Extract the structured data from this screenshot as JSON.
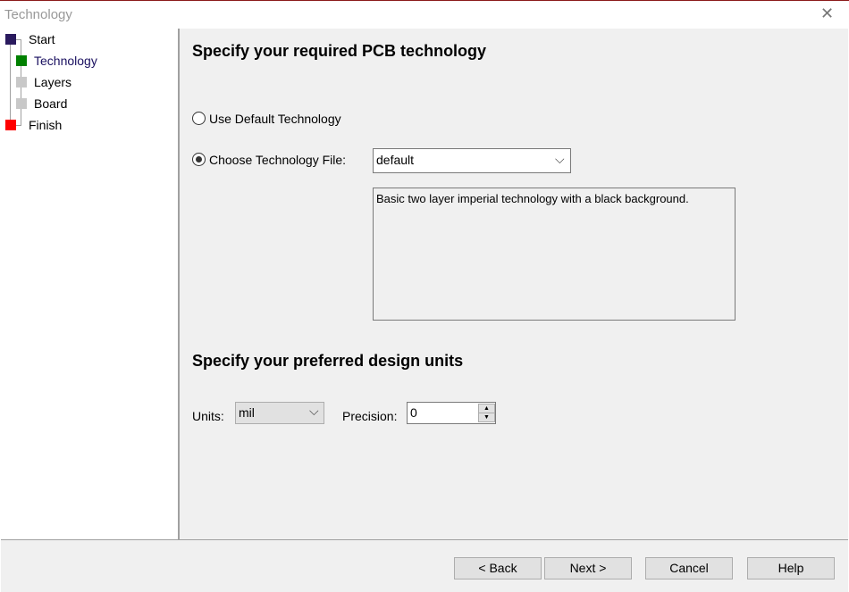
{
  "window": {
    "title": "Technology",
    "close_icon": "close-icon"
  },
  "steps": [
    {
      "label": "Start",
      "color": "#2a1a5e"
    },
    {
      "label": "Technology",
      "color": "#008000"
    },
    {
      "label": "Layers",
      "color": "#c8c8c8"
    },
    {
      "label": "Board",
      "color": "#c8c8c8"
    },
    {
      "label": "Finish",
      "color": "#ff0000"
    }
  ],
  "main": {
    "heading1": "Specify your required PCB technology",
    "radio_default": "Use Default Technology",
    "radio_choose": "Choose Technology File:",
    "selected_radio": "choose",
    "tech_file": "default",
    "description": "Basic two layer imperial technology with a black background.",
    "heading2": "Specify your preferred design units",
    "units_label": "Units:",
    "units_value": "mil",
    "precision_label": "Precision:",
    "precision_value": "0"
  },
  "footer": {
    "back": "< Back",
    "next": "Next >",
    "cancel": "Cancel",
    "help": "Help"
  }
}
